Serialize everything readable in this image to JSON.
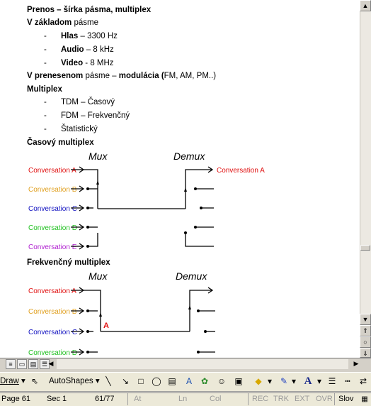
{
  "doc": {
    "heading": "Prenos – šírka pásma, multiplex",
    "baseband": {
      "bold": "V základom",
      "rest": " pásme"
    },
    "bullets_bw": [
      {
        "label": "Hlas",
        "value": " – 3300 Hz"
      },
      {
        "label": "Audio",
        "value": " – 8 kHz"
      },
      {
        "label": "Video",
        "value": " - 8 MHz"
      }
    ],
    "modulated": {
      "bold1": "V prenesenom",
      "mid": " pásme – ",
      "bold2": "modulácia (",
      "rest": "FM, AM, PM..)"
    },
    "multiplex_heading": "Multiplex",
    "bullets_mux": [
      "TDM – Časový",
      "FDM – Frekvenčný",
      "Štatistický"
    ],
    "bullet_char": "-",
    "tdm_heading": "Časový multiplex",
    "fdm_heading": "Frekvenčný multiplex",
    "tdm_diagram": {
      "mux_label": "Mux",
      "demux_label": "Demux",
      "inputs": [
        {
          "label": "Conversation A",
          "color": "#e01010"
        },
        {
          "label": "Conversation B",
          "color": "#e0a020"
        },
        {
          "label": "Conversation C",
          "color": "#1010c0"
        },
        {
          "label": "Conversation D",
          "color": "#20c020"
        },
        {
          "label": "Conversation E",
          "color": "#b020d0"
        }
      ],
      "output": {
        "label": "Conversation A",
        "color": "#e01010"
      }
    },
    "fdm_diagram": {
      "mux_label": "Mux",
      "demux_label": "Demux",
      "channel_label": "A",
      "channel_color": "#e01010",
      "inputs": [
        {
          "label": "Conversation A",
          "color": "#e01010"
        },
        {
          "label": "Conversation B",
          "color": "#e0a020"
        },
        {
          "label": "Conversation C",
          "color": "#1010c0"
        },
        {
          "label": "Conversation D",
          "color": "#20c020"
        }
      ]
    }
  },
  "toolbar": {
    "draw_label": "Draw",
    "autoshapes_label": "AutoShapes"
  },
  "status": {
    "page": "Page  61",
    "sec": "Sec  1",
    "pages": "61/77",
    "at": "At",
    "ln": "Ln",
    "col": "Col",
    "rec": "REC",
    "trk": "TRK",
    "ext": "EXT",
    "ovr": "OVR",
    "lang": "Slov"
  }
}
